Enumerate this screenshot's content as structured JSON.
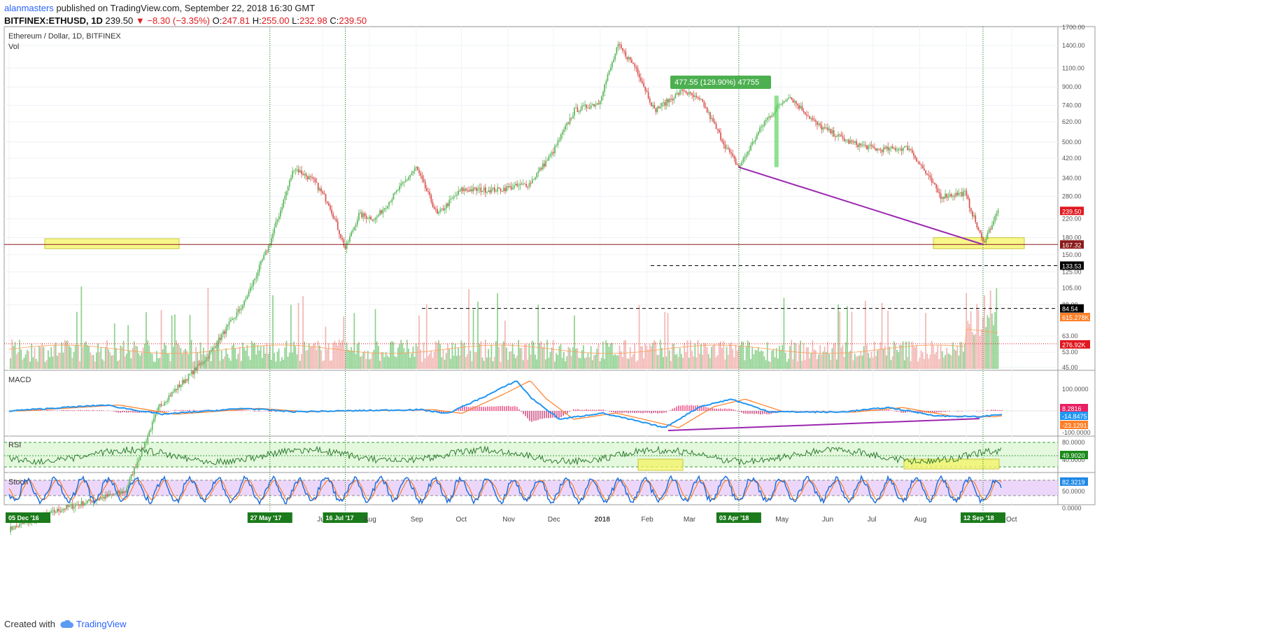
{
  "header": {
    "author": "alanmasters",
    "published_text": "published on TradingView.com, September 22, 2018 16:30 GMT",
    "symbol": "BITFINEX:ETHUSD, 1D",
    "last": "239.50",
    "change": "−8.30 (−3.35%)",
    "open_label": "O:",
    "open": "247.81",
    "high_label": "H:",
    "high": "255.00",
    "low_label": "L:",
    "low": "232.98",
    "close_label": "C:",
    "close": "239.50"
  },
  "footer": {
    "created_with": "Created with",
    "brand": "TradingView"
  },
  "colors": {
    "up": "#5cb85c",
    "down": "#d9534f",
    "accent": "#2962ff",
    "macd": "#2196f3",
    "signal": "#ff7f27",
    "trendline": "#9c27b0",
    "rsi_band": "#d8f5cf",
    "stoch_band": "#e7cdfa",
    "highlight": "#f5f564"
  },
  "chart_data": [
    {
      "type": "candlestick",
      "title": "Ethereum / Dollar, 1D, BITFINEX",
      "subtitle": "Vol",
      "y_scale": "log",
      "ylim": [
        45,
        1700
      ],
      "yticks": [
        "1700.00",
        "1400.00",
        "1100.00",
        "900.00",
        "740.00",
        "620.00",
        "500.00",
        "420.00",
        "340.00",
        "280.00",
        "220.00",
        "180.00",
        "150.00",
        "125.00",
        "105.00",
        "88.00",
        "63.00",
        "53.00",
        "45.00"
      ],
      "xticks": [
        "05 Dec '16",
        "27 May '17",
        "Jul",
        "16 Jul '17",
        "Aug",
        "Sep",
        "Oct",
        "Nov",
        "Dec",
        "2018",
        "Feb",
        "Mar",
        "03 Apr '18",
        "May",
        "Jun",
        "Jul",
        "Aug",
        "Sep",
        "12 Sep '18",
        "Oct"
      ],
      "close_path": [
        [
          "2016-12-05",
          8
        ],
        [
          "2017-01-10",
          10
        ],
        [
          "2017-02-20",
          12
        ],
        [
          "2017-03-15",
          30
        ],
        [
          "2017-04-15",
          50
        ],
        [
          "2017-05-10",
          90
        ],
        [
          "2017-05-27",
          170
        ],
        [
          "2017-06-12",
          380
        ],
        [
          "2017-06-25",
          330
        ],
        [
          "2017-07-05",
          260
        ],
        [
          "2017-07-16",
          160
        ],
        [
          "2017-07-25",
          230
        ],
        [
          "2017-08-05",
          220
        ],
        [
          "2017-08-20",
          300
        ],
        [
          "2017-09-01",
          380
        ],
        [
          "2017-09-15",
          230
        ],
        [
          "2017-10-01",
          300
        ],
        [
          "2017-10-25",
          300
        ],
        [
          "2017-11-15",
          320
        ],
        [
          "2017-11-30",
          440
        ],
        [
          "2017-12-15",
          700
        ],
        [
          "2017-12-31",
          760
        ],
        [
          "2018-01-13",
          1400
        ],
        [
          "2018-01-25",
          1100
        ],
        [
          "2018-02-06",
          700
        ],
        [
          "2018-02-25",
          870
        ],
        [
          "2018-03-10",
          760
        ],
        [
          "2018-03-25",
          480
        ],
        [
          "2018-04-03",
          380
        ],
        [
          "2018-04-20",
          620
        ],
        [
          "2018-05-06",
          820
        ],
        [
          "2018-05-25",
          600
        ],
        [
          "2018-06-15",
          500
        ],
        [
          "2018-07-05",
          460
        ],
        [
          "2018-07-25",
          470
        ],
        [
          "2018-08-15",
          280
        ],
        [
          "2018-08-31",
          290
        ],
        [
          "2018-09-12",
          170
        ],
        [
          "2018-09-22",
          239.5
        ]
      ],
      "highlight_text": "477.55 (129.90%) 47755",
      "price_labels": [
        {
          "value": "239.50",
          "color": "#e0181f"
        },
        {
          "value": "167.32",
          "color": "#8b1a1a"
        },
        {
          "value": "133.53",
          "color": "#000000"
        },
        {
          "value": "84.54",
          "color": "#000000"
        }
      ],
      "volume_labels": [
        {
          "value": "615.278K",
          "color": "#ff7f27"
        },
        {
          "value": "276.92K",
          "color": "#e0181f"
        }
      ],
      "vertical_markers": [
        "27 May '17",
        "16 Jul '17",
        "03 Apr '18",
        "12 Sep '18"
      ]
    },
    {
      "type": "line",
      "title": "MACD",
      "ylim": [
        -100,
        100
      ],
      "yticks": [
        "100.0000",
        "-100.0000"
      ],
      "series": [
        {
          "values_note": "",
          "last": "8.2816"
        },
        {
          "last": "-14.8475"
        },
        {
          "last": "-23.1291"
        }
      ]
    },
    {
      "type": "line",
      "title": "RSI",
      "ylim": [
        20,
        85
      ],
      "yticks": [
        "80.0000",
        "40.0000"
      ],
      "last": "49.9020"
    },
    {
      "type": "line",
      "title": "Stoch",
      "ylim": [
        0,
        100
      ],
      "yticks": [
        "50.0000",
        "0.0000"
      ],
      "last": "82.3219"
    }
  ]
}
